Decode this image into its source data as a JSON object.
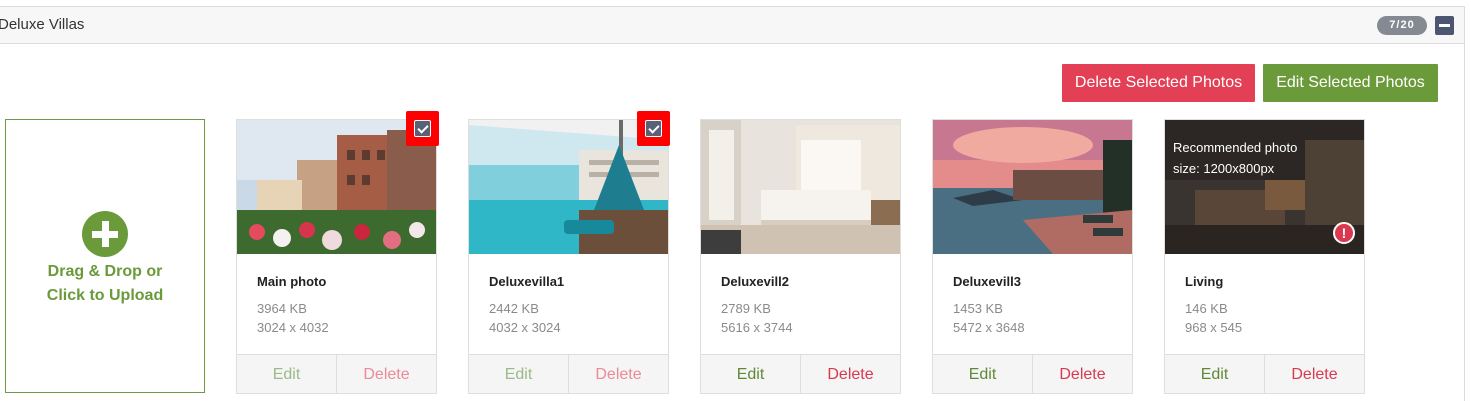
{
  "section": {
    "title": "Deluxe Villas",
    "count_badge": "7/20"
  },
  "toolbar": {
    "delete_selected_label": "Delete Selected Photos",
    "edit_selected_label": "Edit Selected Photos"
  },
  "upload": {
    "line1": "Drag & Drop or",
    "line2": "Click to Upload",
    "icon": "plus-circle-icon"
  },
  "photos": [
    {
      "name": "Main photo",
      "size": "3964 KB",
      "dimensions": "3024 x 4032",
      "selected": true,
      "edit_label": "Edit",
      "delete_label": "Delete"
    },
    {
      "name": "Deluxevilla1",
      "size": "2442 KB",
      "dimensions": "4032 x 3024",
      "selected": true,
      "edit_label": "Edit",
      "delete_label": "Delete"
    },
    {
      "name": "Deluxevill2",
      "size": "2789 KB",
      "dimensions": "5616 x 3744",
      "selected": false,
      "edit_label": "Edit",
      "delete_label": "Delete"
    },
    {
      "name": "Deluxevill3",
      "size": "1453 KB",
      "dimensions": "5472 x 3648",
      "selected": false,
      "edit_label": "Edit",
      "delete_label": "Delete"
    },
    {
      "name": "Living",
      "size": "146 KB",
      "dimensions": "968 x 545",
      "selected": false,
      "edit_label": "Edit",
      "delete_label": "Delete",
      "overlay_line1": "Recommended photo",
      "overlay_line2": "size: 1200x800px",
      "warning_icon": "!"
    }
  ],
  "colors": {
    "delete_red": "#e33f55",
    "edit_green": "#6a9a3a",
    "badge_gray": "#858a92",
    "highlight_red": "#ff0000"
  }
}
